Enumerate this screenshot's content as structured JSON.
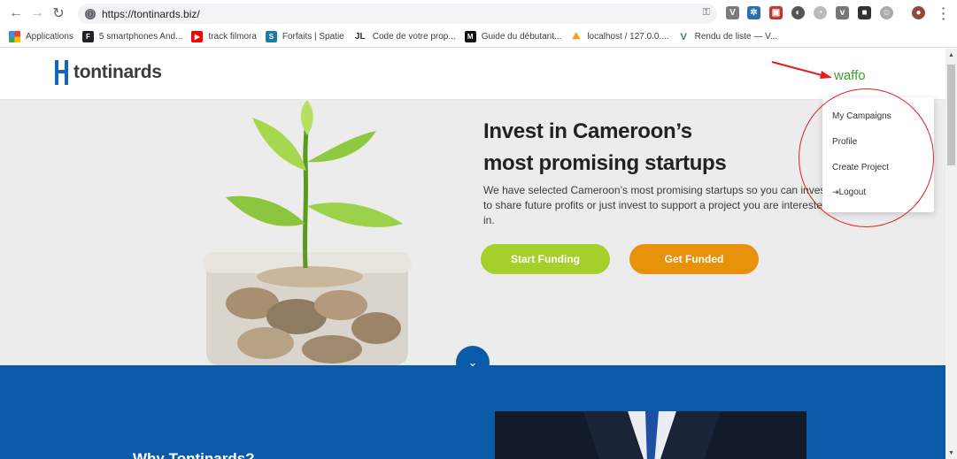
{
  "browser": {
    "url": "https://tontinards.biz/",
    "bookmarks": [
      {
        "label": "Applications",
        "color": "#ea4335",
        "glyph": ""
      },
      {
        "label": "5 smartphones And...",
        "color": "#202124",
        "glyph": "F"
      },
      {
        "label": "track filmora",
        "color": "#ff0000",
        "glyph": "▶"
      },
      {
        "label": "Forfaits | Spatie",
        "color": "#1b7ea1",
        "glyph": "S"
      },
      {
        "label": "Code de votre prop...",
        "color": "#ffffff",
        "glyph": "JL"
      },
      {
        "label": "Guide du débutant...",
        "color": "#111111",
        "glyph": "M"
      },
      {
        "label": "localhost / 127.0.0....",
        "color": "#f0a020",
        "glyph": "⛰"
      },
      {
        "label": "Rendu de liste — V...",
        "color": "#2e8b57",
        "glyph": "V"
      }
    ]
  },
  "header": {
    "logo_text": "tontinards",
    "user_name": "waffo"
  },
  "user_menu": {
    "items": [
      "My Campaigns",
      "Profile",
      "Create Project",
      "Logout"
    ]
  },
  "hero": {
    "title_line1": "Invest in Cameroon’s",
    "title_line2": "most promising startups",
    "description": "We have selected Cameroon’s most promising startups so you can invest to share future profits or just invest to support a project you are interested in.",
    "start_funding": "Start Funding",
    "get_funded": "Get Funded"
  },
  "section": {
    "why_title": "Why Tontinards?"
  },
  "colors": {
    "brand_blue": "#0b5aa8",
    "user_green": "#3a9d2c",
    "start_green": "#a5cf2a",
    "funded_orange": "#e8920b",
    "annotation_red": "#e02020"
  }
}
